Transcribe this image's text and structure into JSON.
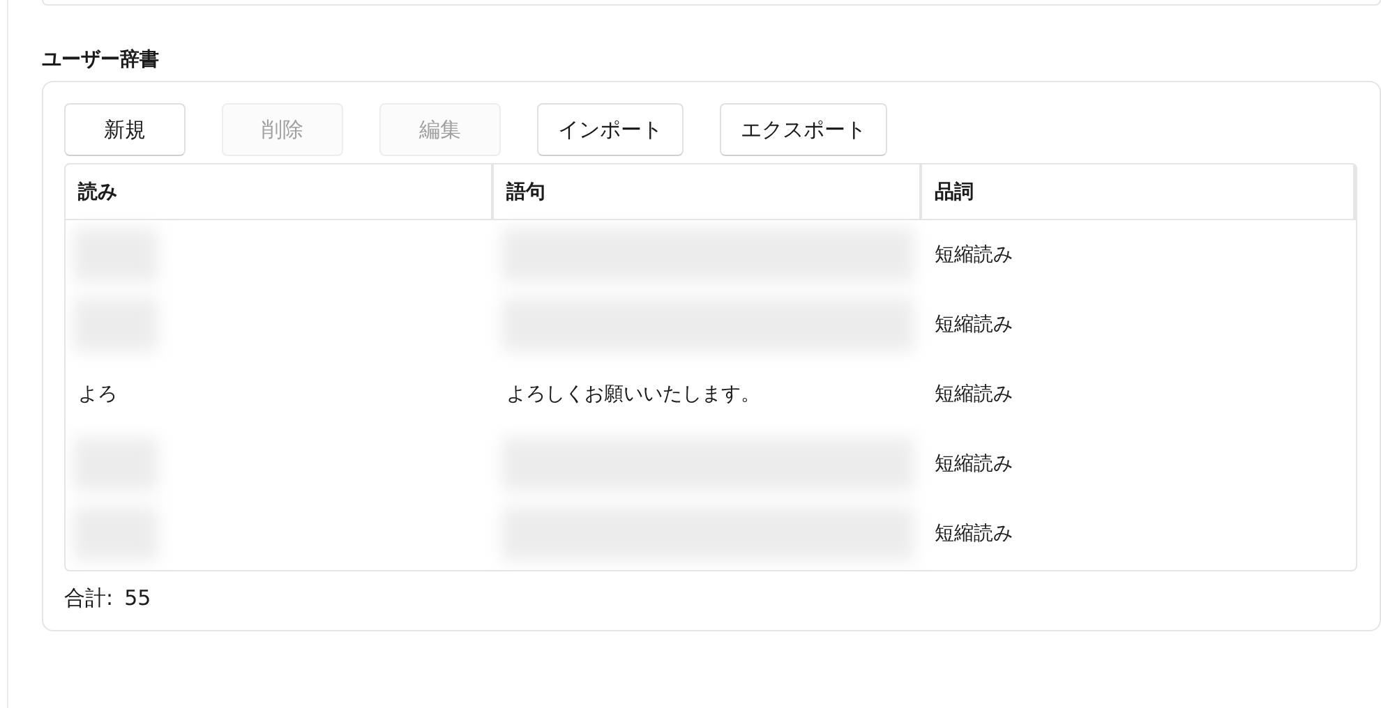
{
  "section_title": "ユーザー辞書",
  "toolbar": [
    {
      "label": "新規",
      "disabled": false
    },
    {
      "label": "削除",
      "disabled": true
    },
    {
      "label": "編集",
      "disabled": true
    },
    {
      "label": "インポート",
      "disabled": false
    },
    {
      "label": "エクスポート",
      "disabled": false
    }
  ],
  "table": {
    "columns": [
      "読み",
      "語句",
      "品詞"
    ],
    "rows": [
      {
        "reading_blurred": true,
        "phrase_blurred": true,
        "part_of_speech": "短縮読み"
      },
      {
        "reading_blurred": true,
        "phrase_blurred": true,
        "part_of_speech": "短縮読み"
      },
      {
        "reading": "よろ",
        "phrase": "よろしくお願いいたします。",
        "part_of_speech": "短縮読み"
      },
      {
        "reading_blurred": true,
        "phrase_blurred": true,
        "part_of_speech": "短縮読み"
      },
      {
        "reading_blurred": true,
        "phrase_blurred": true,
        "part_of_speech": "短縮読み"
      }
    ]
  },
  "total": {
    "label": "合計:",
    "value": "55"
  }
}
